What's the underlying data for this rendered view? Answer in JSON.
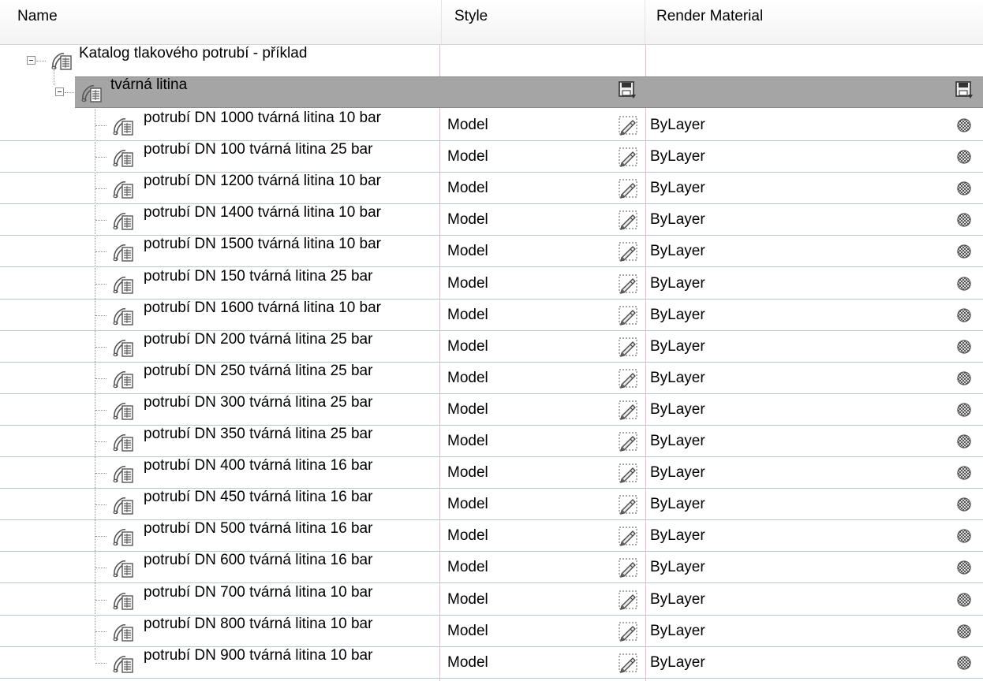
{
  "columns": {
    "name": "Name",
    "style": "Style",
    "render_material": "Render Material"
  },
  "root": {
    "label": "Katalog tlakového potrubí - příklad"
  },
  "group": {
    "label": "tvárná litina"
  },
  "items": [
    {
      "name": "potrubí DN 1000 tvárná litina 10 bar",
      "style": "Model",
      "material": "ByLayer"
    },
    {
      "name": "potrubí DN 100 tvárná litina 25 bar",
      "style": "Model",
      "material": "ByLayer"
    },
    {
      "name": "potrubí DN 1200 tvárná litina 10 bar",
      "style": "Model",
      "material": "ByLayer"
    },
    {
      "name": "potrubí DN 1400 tvárná litina 10 bar",
      "style": "Model",
      "material": "ByLayer"
    },
    {
      "name": "potrubí DN 1500 tvárná litina 10 bar",
      "style": "Model",
      "material": "ByLayer"
    },
    {
      "name": "potrubí DN 150 tvárná litina 25 bar",
      "style": "Model",
      "material": "ByLayer"
    },
    {
      "name": "potrubí DN 1600 tvárná litina 10 bar",
      "style": "Model",
      "material": "ByLayer"
    },
    {
      "name": "potrubí DN 200 tvárná litina 25 bar",
      "style": "Model",
      "material": "ByLayer"
    },
    {
      "name": "potrubí DN 250 tvárná litina 25 bar",
      "style": "Model",
      "material": "ByLayer"
    },
    {
      "name": "potrubí DN 300 tvárná litina 25 bar",
      "style": "Model",
      "material": "ByLayer"
    },
    {
      "name": "potrubí DN 350 tvárná litina 25 bar",
      "style": "Model",
      "material": "ByLayer"
    },
    {
      "name": "potrubí DN 400 tvárná litina 16 bar",
      "style": "Model",
      "material": "ByLayer"
    },
    {
      "name": "potrubí DN 450 tvárná litina 16 bar",
      "style": "Model",
      "material": "ByLayer"
    },
    {
      "name": "potrubí DN 500 tvárná litina 16 bar",
      "style": "Model",
      "material": "ByLayer"
    },
    {
      "name": "potrubí DN 600 tvárná litina 16 bar",
      "style": "Model",
      "material": "ByLayer"
    },
    {
      "name": "potrubí DN 700 tvárná litina 10 bar",
      "style": "Model",
      "material": "ByLayer"
    },
    {
      "name": "potrubí DN 800 tvárná litina 10 bar",
      "style": "Model",
      "material": "ByLayer"
    },
    {
      "name": "potrubí DN 900 tvárná litina 10 bar",
      "style": "Model",
      "material": "ByLayer"
    }
  ],
  "colors": {
    "selection": "#a5a5a5",
    "row_border": "#b7c7d6",
    "column_guide": "#f2b5bd"
  }
}
